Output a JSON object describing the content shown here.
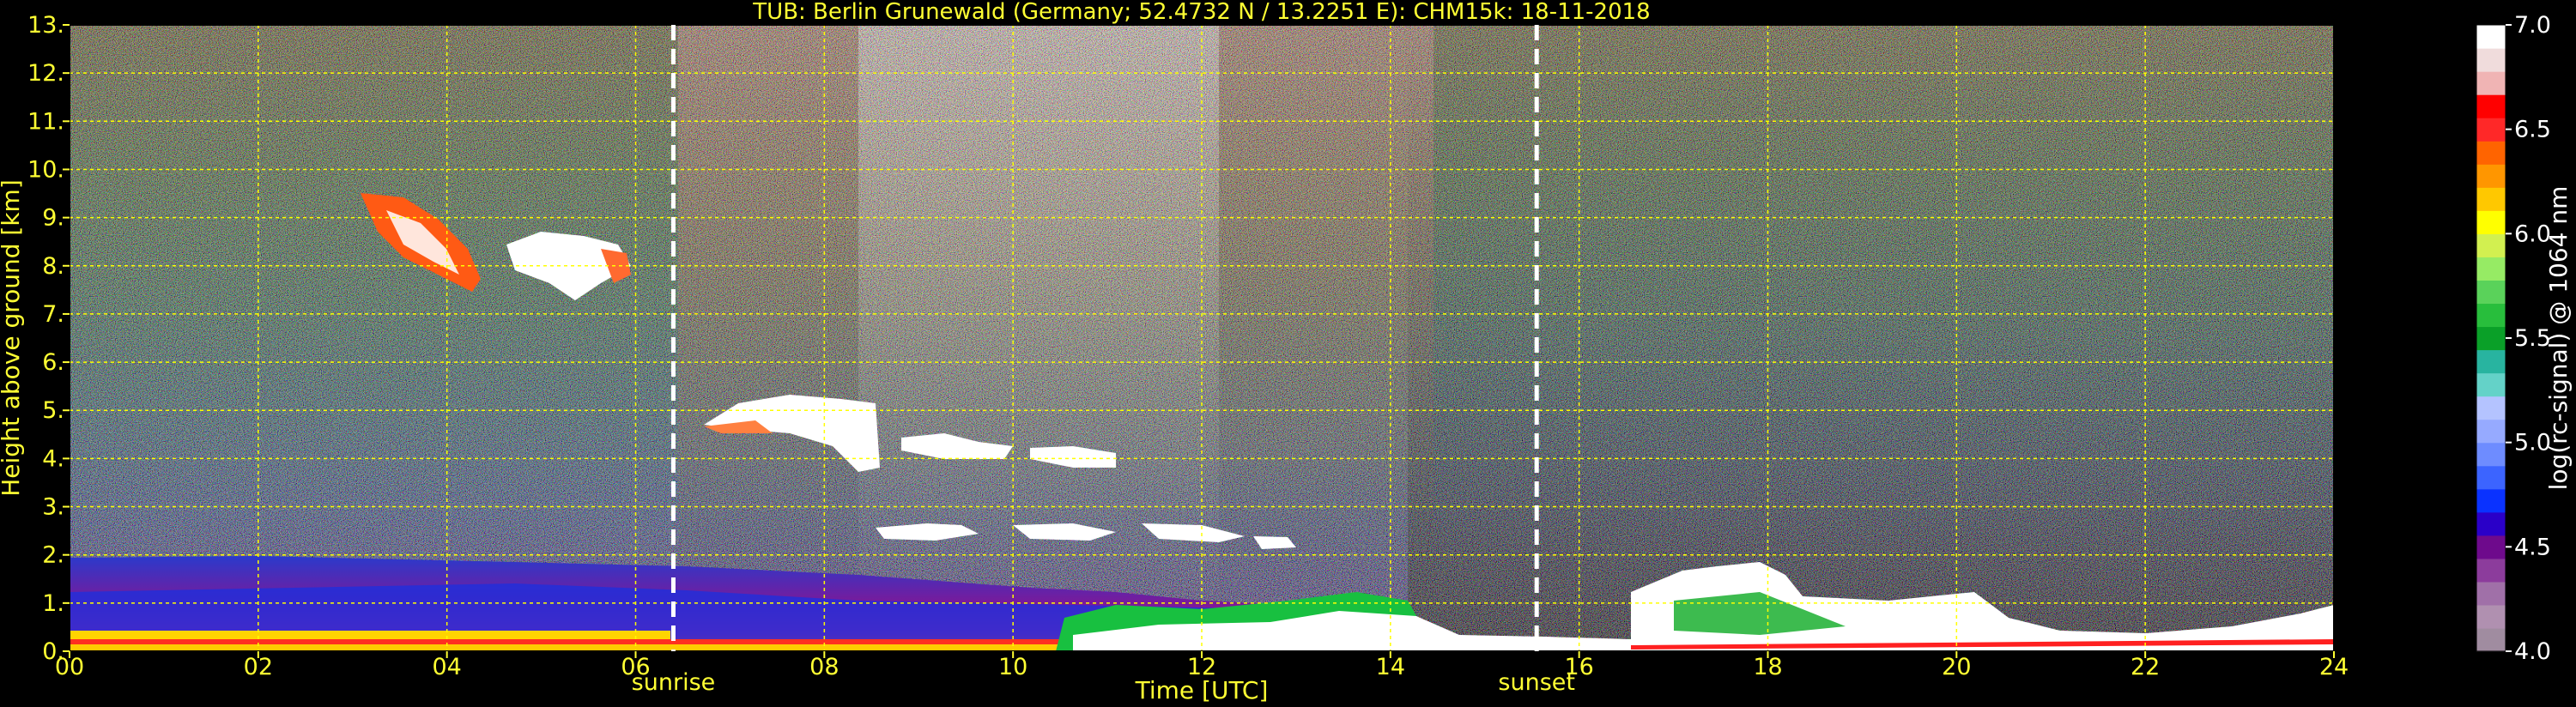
{
  "chart_data": {
    "type": "heatmap",
    "title": "TUB: Berlin Grunewald (Germany; 52.4732 N / 13.2251 E):    CHM15k: 18-11-2018",
    "xlabel": "Time [UTC]",
    "ylabel": "Height above ground [km]",
    "colorbar_label": "log(rc-signal) @ 1064 nm",
    "xlim": [
      0,
      24
    ],
    "ylim": [
      0,
      13
    ],
    "clim": [
      4.0,
      7.0
    ],
    "grid": true,
    "x_ticks": [
      0,
      2,
      4,
      6,
      8,
      10,
      12,
      14,
      16,
      18,
      20,
      22,
      24
    ],
    "x_tick_labels": [
      "00",
      "02",
      "04",
      "06",
      "08",
      "10",
      "12",
      "14",
      "16",
      "18",
      "20",
      "22",
      "24"
    ],
    "y_ticks": [
      0,
      1,
      2,
      3,
      4,
      5,
      6,
      7,
      8,
      9,
      10,
      11,
      12,
      13
    ],
    "y_tick_labels": [
      "0.",
      "1.",
      "2.",
      "3.",
      "4.",
      "5.",
      "6.",
      "7.",
      "8.",
      "9.",
      "10.",
      "11.",
      "12.",
      "13."
    ],
    "colorbar_ticks": [
      4.0,
      4.5,
      5.0,
      5.5,
      6.0,
      6.5,
      7.0
    ],
    "colorbar_tick_labels": [
      "4.0",
      "4.5",
      "5.0",
      "5.5",
      "6.0",
      "6.5",
      "7.0"
    ],
    "colormap": [
      "#a08ca0",
      "#b090b0",
      "#a070a8",
      "#8c3c9c",
      "#6e0a8c",
      "#2a00c8",
      "#0a32ff",
      "#3c64ff",
      "#6e8cff",
      "#96aaff",
      "#b4c3ff",
      "#64d2c8",
      "#28b4a0",
      "#0aa028",
      "#28be3c",
      "#5ad25a",
      "#96eb64",
      "#d2f050",
      "#ffff00",
      "#ffc800",
      "#ff9600",
      "#ff6400",
      "#ff2828",
      "#ff0000",
      "#f0b4b4",
      "#f0dcdc",
      "#ffffff"
    ],
    "markers": [
      {
        "label": "sunrise",
        "time": 6.4
      },
      {
        "label": "sunset",
        "time": 15.55
      }
    ]
  }
}
